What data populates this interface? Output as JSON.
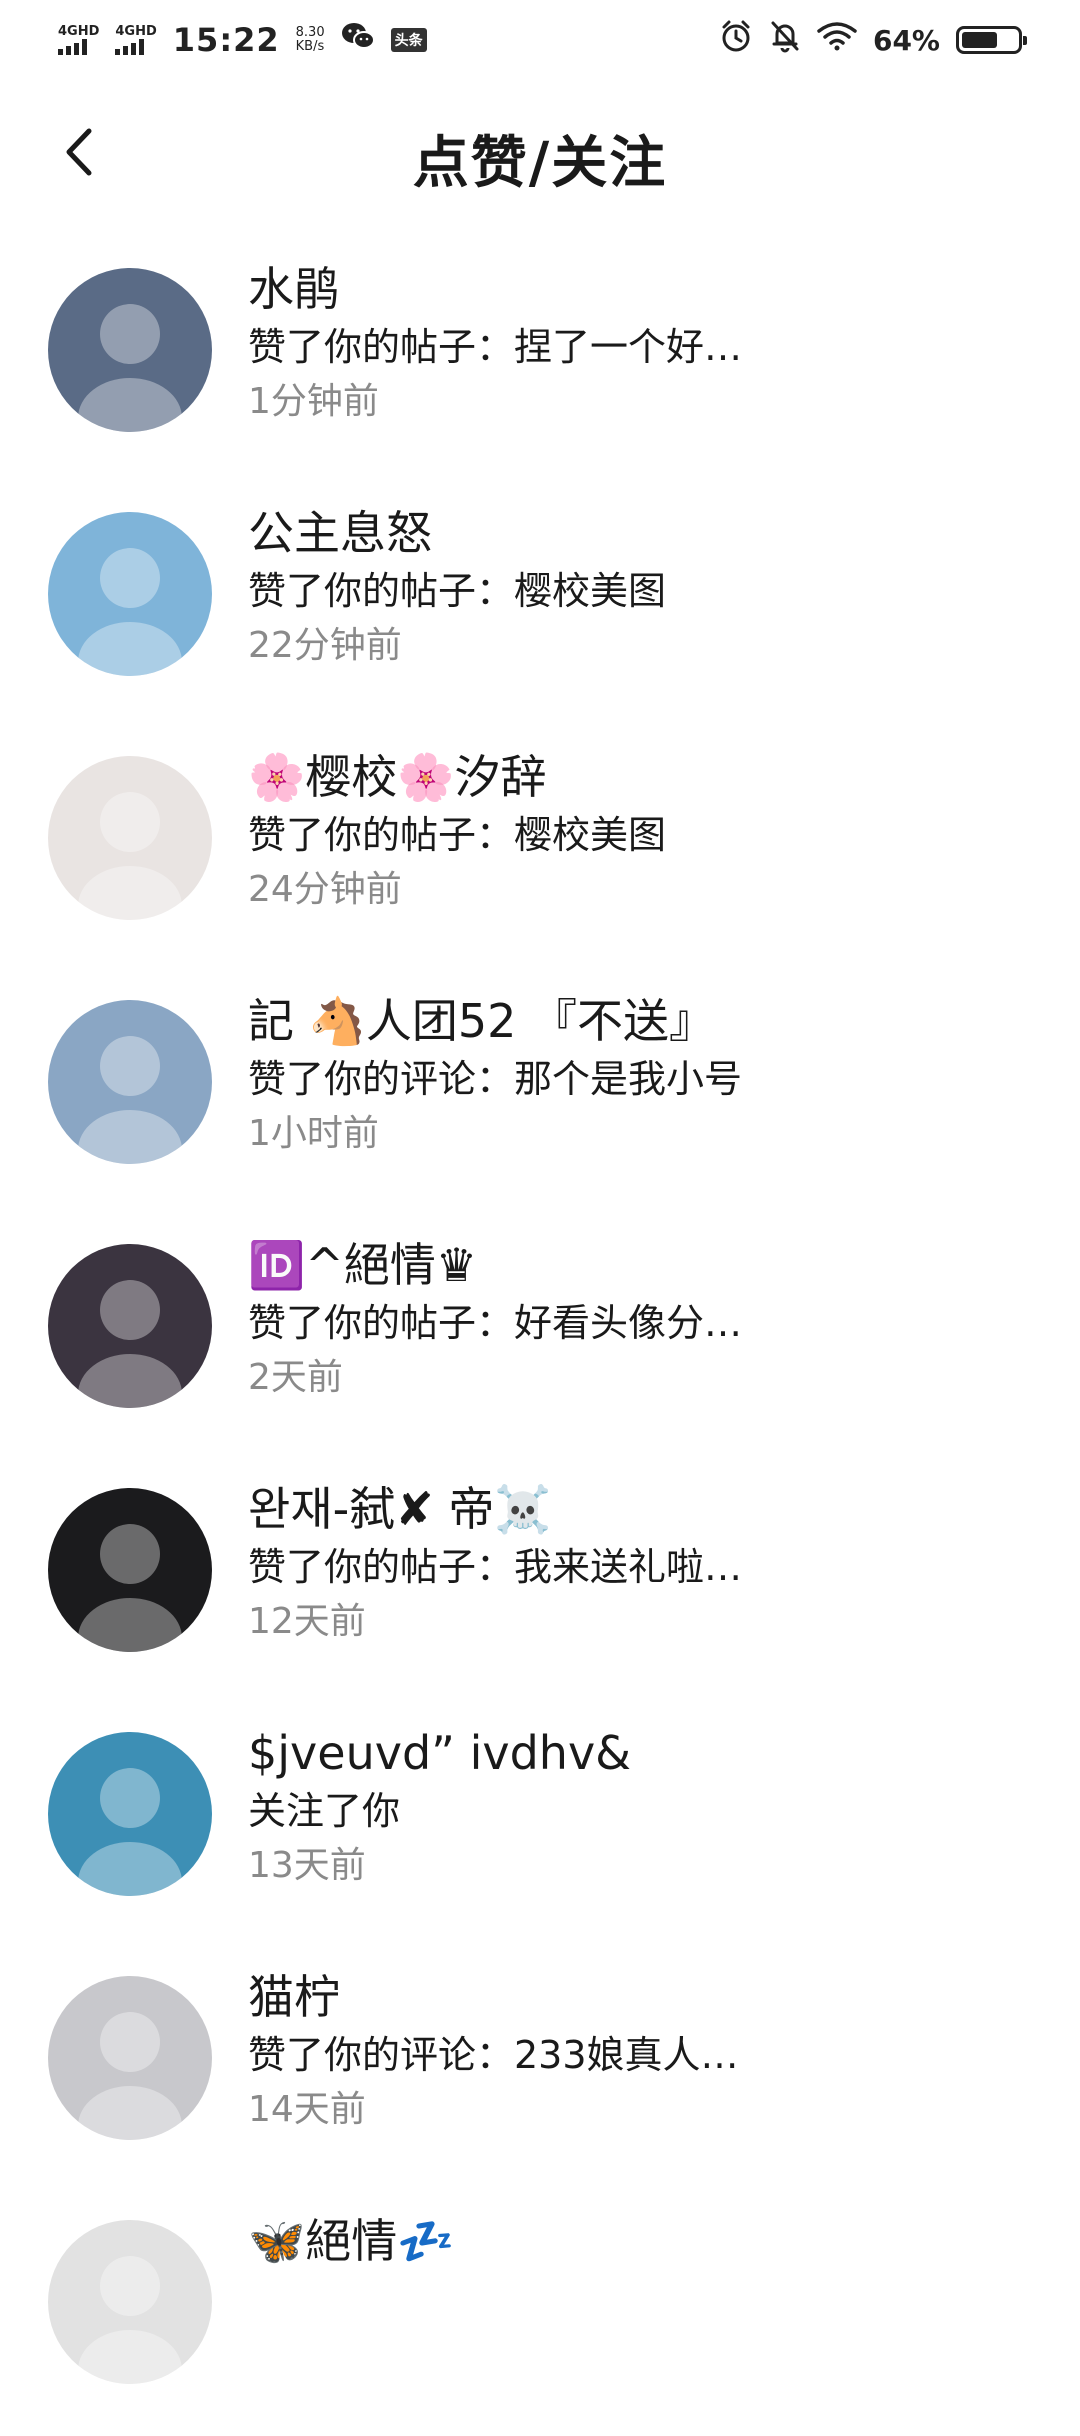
{
  "status_bar": {
    "network_1": "4GHD",
    "network_2": "4GHD",
    "time": "15:22",
    "speed_value": "8.30",
    "speed_unit": "KB/s",
    "app_chip": "头条",
    "battery": "64%",
    "battery_level": 0.64
  },
  "header": {
    "title": "点赞/关注"
  },
  "notifications": [
    {
      "name": "水鹃",
      "action": "赞了你的帖子：捏了一个好…",
      "time": "1分钟前",
      "avatar_bg": "#5a6b86"
    },
    {
      "name": "公主息怒",
      "action": "赞了你的帖子：樱校美图",
      "time": "22分钟前",
      "avatar_bg": "#7fb4d9"
    },
    {
      "name": "🌸樱校🌸汐辞",
      "action": "赞了你的帖子：樱校美图",
      "time": "24分钟前",
      "avatar_bg": "#e9e4e2"
    },
    {
      "name": "記 🐴人团52 『不送』",
      "action": "赞了你的评论：那个是我小号",
      "time": "1小时前",
      "avatar_bg": "#8aa6c4"
    },
    {
      "name": "🆔^絕情♛",
      "action": "赞了你的帖子：好看头像分…",
      "time": "2天前",
      "avatar_bg": "#3b3440"
    },
    {
      "name": "완재-弑✘ 帝☠️",
      "action": "赞了你的帖子：我来送礼啦…",
      "time": "12天前",
      "avatar_bg": "#1b1b1d"
    },
    {
      "name": "$jveuvd” ivdhv&",
      "action": "关注了你",
      "time": "13天前",
      "avatar_bg": "#3d8fb5"
    },
    {
      "name": "猫柠",
      "action": "赞了你的评论：233娘真人…",
      "time": "14天前",
      "avatar_bg": "#c8c8cc"
    },
    {
      "name": "🦋絕情💤",
      "action": "",
      "time": "",
      "avatar_bg": "#e2e2e2"
    }
  ]
}
